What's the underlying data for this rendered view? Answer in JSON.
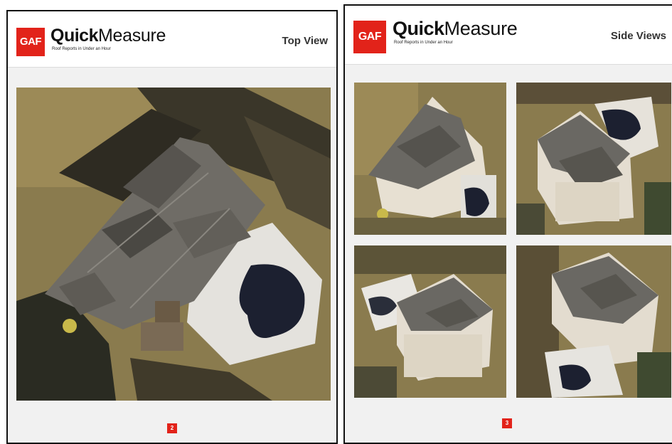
{
  "left_page": {
    "logo_text": "GAF",
    "brand_bold": "Quick",
    "brand_light": "Measure",
    "tagline": "Roof Reports in Under an Hour",
    "view_title": "Top View",
    "page_number": "2",
    "photo_icon": "aerial-top-view-house-image"
  },
  "right_page": {
    "logo_text": "GAF",
    "brand_bold": "Quick",
    "brand_light": "Measure",
    "tagline": "Roof Reports in Under an Hour",
    "view_title": "Side Views",
    "page_number": "3",
    "photo_icons": [
      "aerial-side-view-image",
      "aerial-side-view-image",
      "aerial-side-view-image",
      "aerial-side-view-image"
    ]
  },
  "colors": {
    "brand_red": "#e2231a",
    "grass": "#8a7b4e",
    "shadow": "#2a2a22",
    "roof": "#6f6c66",
    "pool": "#1b2030",
    "deck": "#e6e4df"
  }
}
